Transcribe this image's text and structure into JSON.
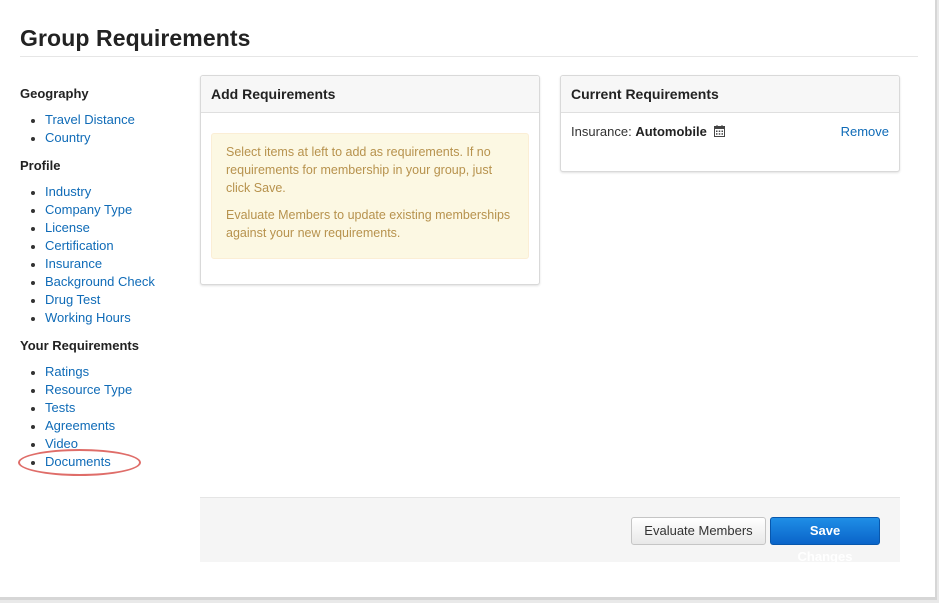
{
  "page": {
    "title": "Group Requirements"
  },
  "sidebar": {
    "groups": [
      {
        "heading": "Geography",
        "items": [
          "Travel Distance",
          "Country"
        ]
      },
      {
        "heading": "Profile",
        "items": [
          "Industry",
          "Company Type",
          "License",
          "Certification",
          "Insurance",
          "Background Check",
          "Drug Test",
          "Working Hours"
        ]
      },
      {
        "heading": "Your Requirements",
        "items": [
          "Ratings",
          "Resource Type",
          "Tests",
          "Agreements",
          "Video",
          "Documents"
        ]
      }
    ]
  },
  "add_panel": {
    "header": "Add Requirements",
    "notice_line1": "Select items at left to add as requirements. If no requirements for membership in your group, just click Save.",
    "notice_line2": "Evaluate Members to update existing memberships against your new requirements."
  },
  "current_panel": {
    "header": "Current Requirements",
    "requirement_label": "Insurance:",
    "requirement_value": "Automobile",
    "requirement_icon": "calendar-icon",
    "remove_label": "Remove"
  },
  "footer": {
    "evaluate_label": "Evaluate Members",
    "save_label": "Save Changes"
  },
  "colors": {
    "link": "#0f6bb7",
    "primary_button": "#0a64c9",
    "notice_bg": "#fcf8e3",
    "notice_text": "#b7924d",
    "annotation_circle": "#d9534f"
  }
}
